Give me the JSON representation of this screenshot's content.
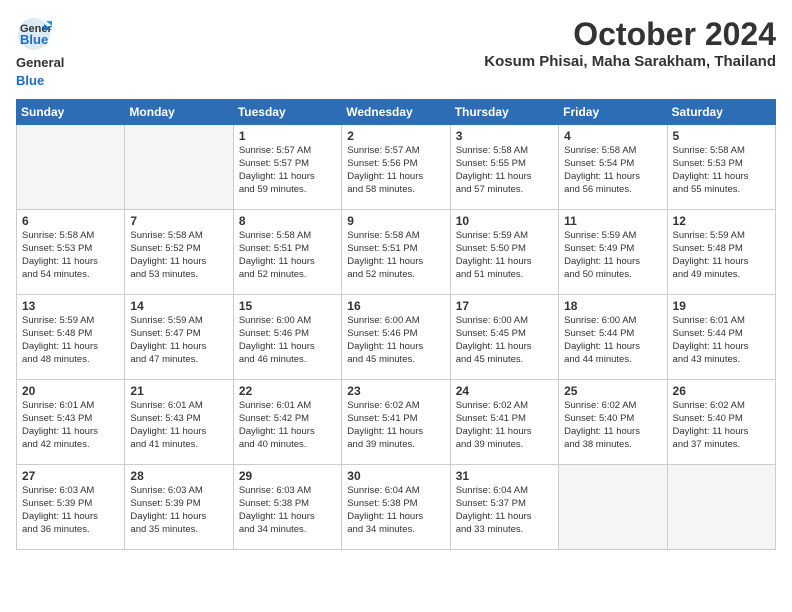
{
  "header": {
    "logo_line1": "General",
    "logo_line2": "Blue",
    "month": "October 2024",
    "location": "Kosum Phisai, Maha Sarakham, Thailand"
  },
  "days_of_week": [
    "Sunday",
    "Monday",
    "Tuesday",
    "Wednesday",
    "Thursday",
    "Friday",
    "Saturday"
  ],
  "weeks": [
    [
      {
        "day": "",
        "info": ""
      },
      {
        "day": "",
        "info": ""
      },
      {
        "day": "1",
        "info": "Sunrise: 5:57 AM\nSunset: 5:57 PM\nDaylight: 11 hours\nand 59 minutes."
      },
      {
        "day": "2",
        "info": "Sunrise: 5:57 AM\nSunset: 5:56 PM\nDaylight: 11 hours\nand 58 minutes."
      },
      {
        "day": "3",
        "info": "Sunrise: 5:58 AM\nSunset: 5:55 PM\nDaylight: 11 hours\nand 57 minutes."
      },
      {
        "day": "4",
        "info": "Sunrise: 5:58 AM\nSunset: 5:54 PM\nDaylight: 11 hours\nand 56 minutes."
      },
      {
        "day": "5",
        "info": "Sunrise: 5:58 AM\nSunset: 5:53 PM\nDaylight: 11 hours\nand 55 minutes."
      }
    ],
    [
      {
        "day": "6",
        "info": "Sunrise: 5:58 AM\nSunset: 5:53 PM\nDaylight: 11 hours\nand 54 minutes."
      },
      {
        "day": "7",
        "info": "Sunrise: 5:58 AM\nSunset: 5:52 PM\nDaylight: 11 hours\nand 53 minutes."
      },
      {
        "day": "8",
        "info": "Sunrise: 5:58 AM\nSunset: 5:51 PM\nDaylight: 11 hours\nand 52 minutes."
      },
      {
        "day": "9",
        "info": "Sunrise: 5:58 AM\nSunset: 5:51 PM\nDaylight: 11 hours\nand 52 minutes."
      },
      {
        "day": "10",
        "info": "Sunrise: 5:59 AM\nSunset: 5:50 PM\nDaylight: 11 hours\nand 51 minutes."
      },
      {
        "day": "11",
        "info": "Sunrise: 5:59 AM\nSunset: 5:49 PM\nDaylight: 11 hours\nand 50 minutes."
      },
      {
        "day": "12",
        "info": "Sunrise: 5:59 AM\nSunset: 5:48 PM\nDaylight: 11 hours\nand 49 minutes."
      }
    ],
    [
      {
        "day": "13",
        "info": "Sunrise: 5:59 AM\nSunset: 5:48 PM\nDaylight: 11 hours\nand 48 minutes."
      },
      {
        "day": "14",
        "info": "Sunrise: 5:59 AM\nSunset: 5:47 PM\nDaylight: 11 hours\nand 47 minutes."
      },
      {
        "day": "15",
        "info": "Sunrise: 6:00 AM\nSunset: 5:46 PM\nDaylight: 11 hours\nand 46 minutes."
      },
      {
        "day": "16",
        "info": "Sunrise: 6:00 AM\nSunset: 5:46 PM\nDaylight: 11 hours\nand 45 minutes."
      },
      {
        "day": "17",
        "info": "Sunrise: 6:00 AM\nSunset: 5:45 PM\nDaylight: 11 hours\nand 45 minutes."
      },
      {
        "day": "18",
        "info": "Sunrise: 6:00 AM\nSunset: 5:44 PM\nDaylight: 11 hours\nand 44 minutes."
      },
      {
        "day": "19",
        "info": "Sunrise: 6:01 AM\nSunset: 5:44 PM\nDaylight: 11 hours\nand 43 minutes."
      }
    ],
    [
      {
        "day": "20",
        "info": "Sunrise: 6:01 AM\nSunset: 5:43 PM\nDaylight: 11 hours\nand 42 minutes."
      },
      {
        "day": "21",
        "info": "Sunrise: 6:01 AM\nSunset: 5:43 PM\nDaylight: 11 hours\nand 41 minutes."
      },
      {
        "day": "22",
        "info": "Sunrise: 6:01 AM\nSunset: 5:42 PM\nDaylight: 11 hours\nand 40 minutes."
      },
      {
        "day": "23",
        "info": "Sunrise: 6:02 AM\nSunset: 5:41 PM\nDaylight: 11 hours\nand 39 minutes."
      },
      {
        "day": "24",
        "info": "Sunrise: 6:02 AM\nSunset: 5:41 PM\nDaylight: 11 hours\nand 39 minutes."
      },
      {
        "day": "25",
        "info": "Sunrise: 6:02 AM\nSunset: 5:40 PM\nDaylight: 11 hours\nand 38 minutes."
      },
      {
        "day": "26",
        "info": "Sunrise: 6:02 AM\nSunset: 5:40 PM\nDaylight: 11 hours\nand 37 minutes."
      }
    ],
    [
      {
        "day": "27",
        "info": "Sunrise: 6:03 AM\nSunset: 5:39 PM\nDaylight: 11 hours\nand 36 minutes."
      },
      {
        "day": "28",
        "info": "Sunrise: 6:03 AM\nSunset: 5:39 PM\nDaylight: 11 hours\nand 35 minutes."
      },
      {
        "day": "29",
        "info": "Sunrise: 6:03 AM\nSunset: 5:38 PM\nDaylight: 11 hours\nand 34 minutes."
      },
      {
        "day": "30",
        "info": "Sunrise: 6:04 AM\nSunset: 5:38 PM\nDaylight: 11 hours\nand 34 minutes."
      },
      {
        "day": "31",
        "info": "Sunrise: 6:04 AM\nSunset: 5:37 PM\nDaylight: 11 hours\nand 33 minutes."
      },
      {
        "day": "",
        "info": ""
      },
      {
        "day": "",
        "info": ""
      }
    ]
  ]
}
